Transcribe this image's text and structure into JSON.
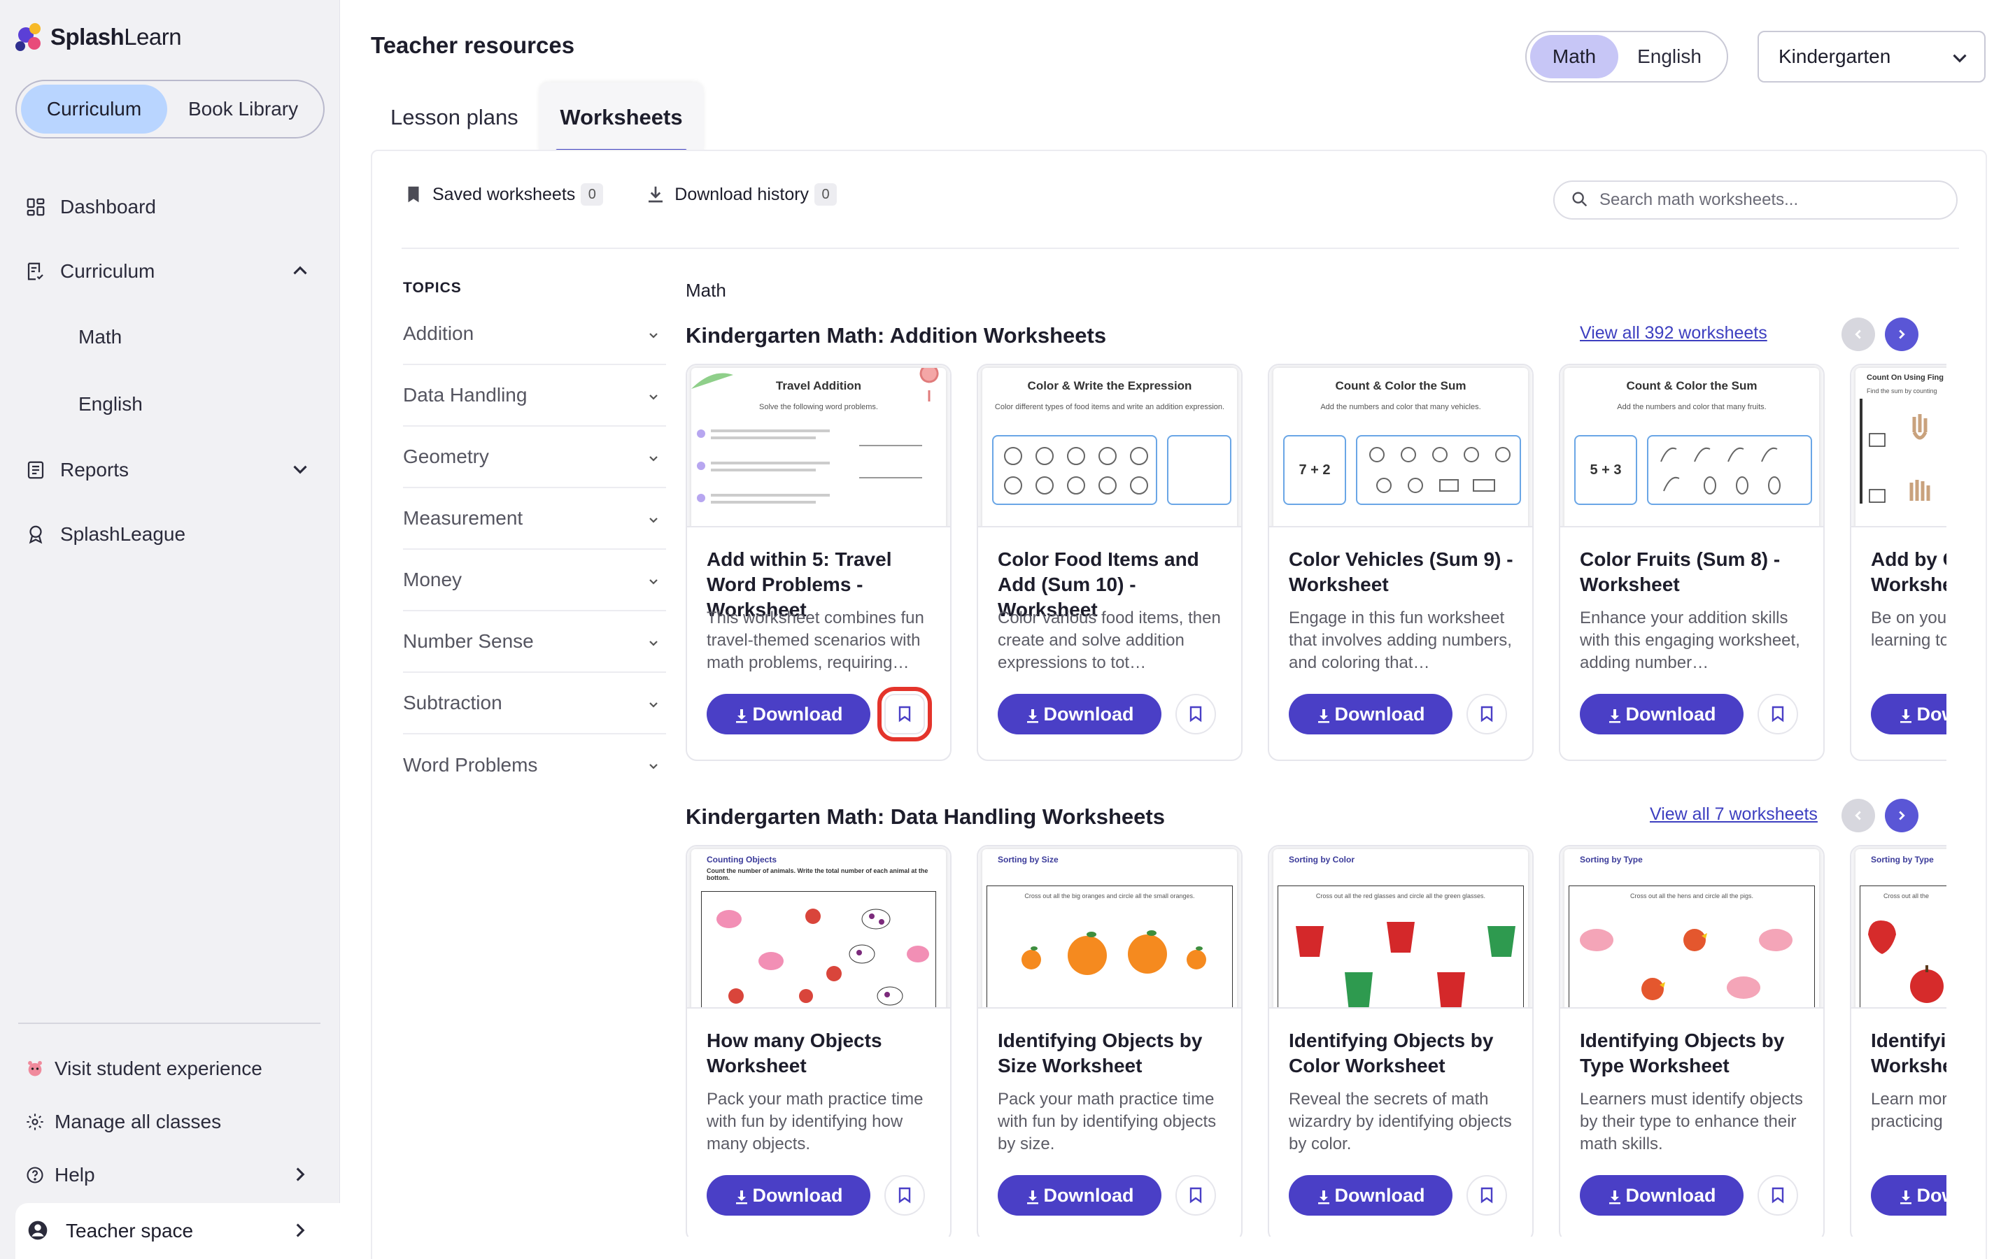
{
  "brand": {
    "bold": "Splash",
    "light": "Learn"
  },
  "sidebar": {
    "segments": [
      "Curriculum",
      "Book Library"
    ],
    "nav": [
      {
        "label": "Dashboard",
        "icon": "dashboard-icon"
      },
      {
        "label": "Curriculum",
        "icon": "curriculum-icon",
        "expanded": true
      },
      {
        "label": "Reports",
        "icon": "reports-icon"
      },
      {
        "label": "SplashLeague",
        "icon": "league-icon"
      }
    ],
    "curriculum_sub": [
      "Math",
      "English"
    ],
    "bottom": [
      "Visit student experience",
      "Manage all classes",
      "Help"
    ],
    "teacher_space": "Teacher space"
  },
  "header": {
    "title": "Teacher resources",
    "subjects": [
      "Math",
      "English"
    ],
    "selected_subject": "Math",
    "grade": "Kindergarten"
  },
  "tabs": [
    "Lesson plans",
    "Worksheets"
  ],
  "active_tab": "Worksheets",
  "toolbar": {
    "saved": {
      "label": "Saved worksheets",
      "count": "0"
    },
    "history": {
      "label": "Download history",
      "count": "0"
    }
  },
  "search": {
    "placeholder": "Search math worksheets...",
    "value": ""
  },
  "topics": {
    "label": "TOPICS",
    "items": [
      "Addition",
      "Data Handling",
      "Geometry",
      "Measurement",
      "Money",
      "Number Sense",
      "Subtraction",
      "Word Problems"
    ]
  },
  "breadcrumb": "Math",
  "sections": [
    {
      "title": "Kindergarten Math: Addition Worksheets",
      "view_all": "View all 392 worksheets",
      "cards": [
        {
          "thumb_title": "Travel Addition",
          "thumb_sub": "Solve the following word problems.",
          "title": "Add within 5: Travel Word Problems - Worksheet",
          "desc": "This worksheet combines fun travel-themed scenarios with math problems, requiring…"
        },
        {
          "thumb_title": "Color & Write the Expression",
          "thumb_sub": "Color different types of food items and write an addition expression.",
          "title": "Color Food Items and Add (Sum 10) - Worksheet",
          "desc": "Color various food items, then create and solve addition expressions to tot…"
        },
        {
          "thumb_title": "Count & Color the Sum",
          "thumb_sub": "Add the numbers and color that many vehicles.",
          "thumb_expr": "7 + 2",
          "title": "Color Vehicles (Sum 9) - Worksheet",
          "desc": "Engage in this fun worksheet that involves adding numbers, and coloring that…"
        },
        {
          "thumb_title": "Count & Color the Sum",
          "thumb_sub": "Add the numbers and color that many fruits.",
          "thumb_expr": "5 + 3",
          "title": "Color Fruits (Sum 8) - Worksheet",
          "desc": "Enhance your addition skills with this engaging worksheet, adding number…"
        },
        {
          "thumb_title": "Count On Using Fing",
          "thumb_sub": "Find the sum by counting",
          "title": "Add by Counting Fingers Worksheet",
          "desc": "Be on your way to mathematics learning to add by"
        }
      ]
    },
    {
      "title": "Kindergarten Math: Data Handling Worksheets",
      "view_all": "View all 7 worksheets",
      "cards": [
        {
          "thumb_title": "Counting Objects",
          "thumb_sub": "Count the number of animals. Write the total number of each animal at the bottom.",
          "title": "How many Objects Worksheet",
          "desc": "Pack your math practice time with fun by identifying how many objects."
        },
        {
          "thumb_title": "Sorting by Size",
          "thumb_sub": "Cross out all the big oranges and circle all the small oranges.",
          "title": "Identifying Objects by Size Worksheet",
          "desc": "Pack your math practice time with fun by identifying objects by size."
        },
        {
          "thumb_title": "Sorting by Color",
          "thumb_sub": "Cross out all the red glasses and circle all the green glasses.",
          "title": "Identifying Objects by Color Worksheet",
          "desc": "Reveal the secrets of math wizardry by identifying objects by color."
        },
        {
          "thumb_title": "Sorting by Type",
          "thumb_sub": "Cross out all the hens and circle all the pigs.",
          "title": "Identifying Objects by Type Worksheet",
          "desc": "Learners must identify objects by their type to enhance their math skills."
        },
        {
          "thumb_title": "Sorting by Type",
          "thumb_sub": "Cross out all the",
          "title": "Identifying Objects Worksheet",
          "desc": "Learn more speed of identifying practicing"
        }
      ]
    }
  ],
  "download_label": "Download",
  "colors": {
    "accent": "#4a3fc6",
    "highlight": "#e4342b",
    "segment_active": "#b9d5ff",
    "subject_active": "#c7c6f6"
  }
}
